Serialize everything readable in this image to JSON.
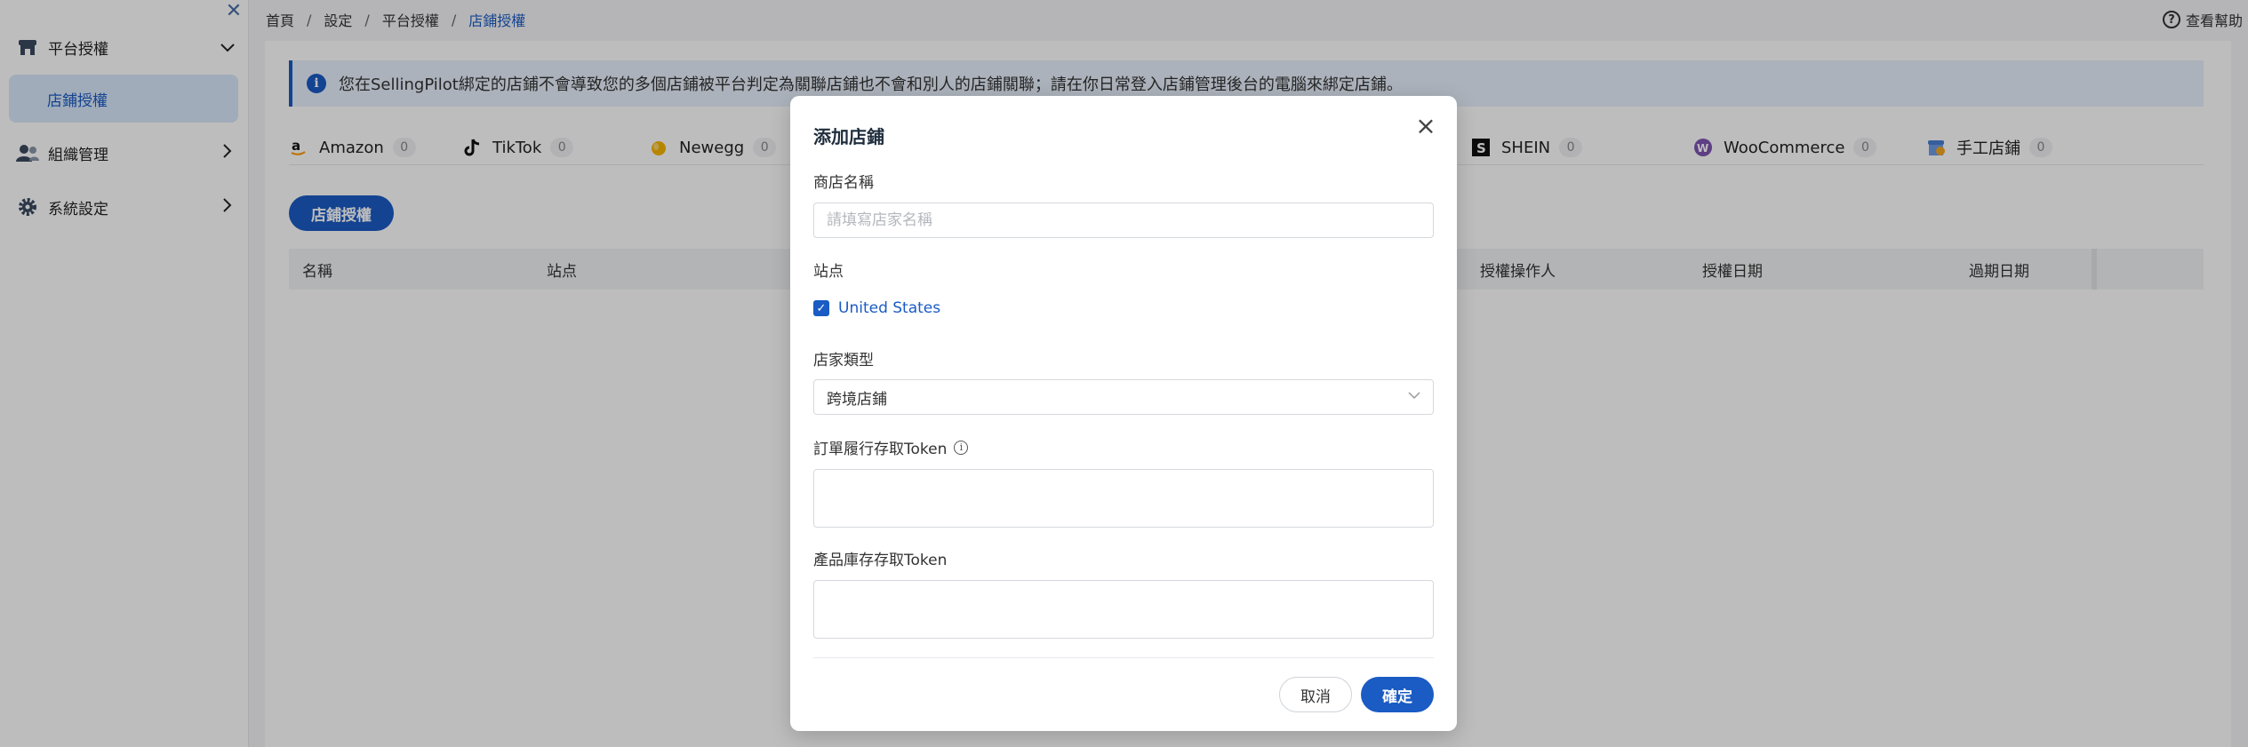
{
  "sidebar": {
    "groups": [
      {
        "label": "平台授權",
        "icon": "store-icon",
        "expanded": true
      },
      {
        "label": "組織管理",
        "icon": "users-icon",
        "expanded": false
      },
      {
        "label": "系統設定",
        "icon": "gear-icon",
        "expanded": false
      }
    ],
    "active_sub_item": "店鋪授權"
  },
  "breadcrumb": [
    "首頁",
    "設定",
    "平台授權",
    "店鋪授權"
  ],
  "breadcrumb_sep": "/",
  "help_label": "查看幫助",
  "help_glyph": "?",
  "notice": {
    "glyph": "i",
    "text": "您在SellingPilot綁定的店鋪不會導致您的多個店鋪被平台判定為關聯店鋪也不會和別人的店鋪關聯；請在你日常登入店鋪管理後台的電腦來綁定店鋪。"
  },
  "platform_tabs": [
    {
      "name": "Amazon",
      "count": "0"
    },
    {
      "name": "TikTok",
      "count": "0"
    },
    {
      "name": "Newegg",
      "count": "0"
    },
    {
      "name": "SHEIN",
      "count": "0"
    },
    {
      "name": "WooCommerce",
      "count": "0"
    },
    {
      "name": "手工店鋪",
      "count": "0"
    }
  ],
  "authorize_button": "店鋪授權",
  "table_headers": [
    "名稱",
    "站点",
    "授權操作人",
    "授權日期",
    "過期日期"
  ],
  "modal": {
    "title": "添加店鋪",
    "store_name_label": "商店名稱",
    "store_name_placeholder": "請填寫店家名稱",
    "store_name_value": "",
    "site_label": "站点",
    "site_option": "United States",
    "site_checked": true,
    "store_type_label": "店家類型",
    "store_type_value": "跨境店鋪",
    "order_token_label": "訂單履行存取Token",
    "order_token_value": "",
    "inventory_token_label": "產品庫存存取Token",
    "inventory_token_value": "",
    "cancel_label": "取消",
    "ok_label": "確定"
  },
  "colors": {
    "primary": "#1a5bc4",
    "active_bg": "#d9e8fb",
    "notice_bg": "#e9f1fc",
    "overlay": "rgba(0,0,0,0.26)"
  }
}
